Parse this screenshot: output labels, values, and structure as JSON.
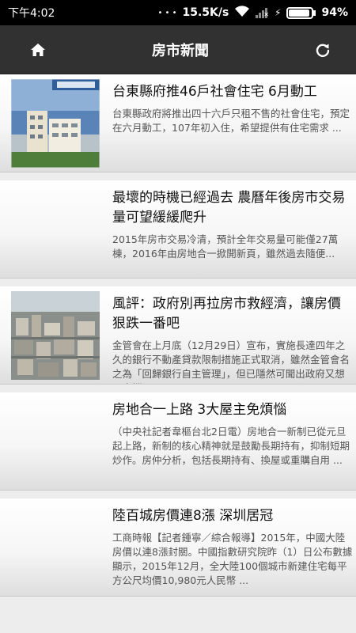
{
  "status": {
    "time": "下午4:02",
    "dots": "• • •",
    "net_speed": "15.5K/s",
    "signal": "✕",
    "charge": "⚡",
    "battery": "94%"
  },
  "appbar": {
    "title": "房市新聞"
  },
  "articles": [
    {
      "title": "台東縣府推46戶社會住宅 6月動工",
      "summary": "台東縣政府將推出四十六戶只租不售的社會住宅，預定在六月動工，107年初入住，希望提供有住宅需求 ..."
    },
    {
      "title": "最壞的時機已經過去 農曆年後房市交易量可望緩緩爬升",
      "summary": "2015年房市交易冷清，預計全年交易量可能僅27萬棟，2016年由房地合一掀開新頁，雖然過去隨便..."
    },
    {
      "title": "風評：政府別再拉房市救經濟，讓房價狠跌一番吧",
      "summary": "金管會在上月底（12月29日）宣布，實施長達四年之久的銀行不動產貸款限制措施正式取消，雖然金管會名之為「回歸銀行自主管理」，但已隱然可聞出政府又想以支撐、..."
    },
    {
      "title": "房地合一上路 3大屋主免煩惱",
      "summary": "（中央社記者韋樞台北2日電）房地合一新制已從元旦起上路，新制的核心精神就是鼓勵長期持有，抑制短期炒作。房仲分析，包括長期持有、換屋或重購自用 ..."
    },
    {
      "title": "陸百城房價連8漲 深圳居冠",
      "summary": "工商時報【記者鍾寧／綜合報導】2015年，中國大陸房價以連8漲封關。中國指數研究院昨（1）日公布數據顯示，2015年12月，全大陸100個城市新建住宅每平方公尺均價10,980元人民幣 ..."
    }
  ]
}
